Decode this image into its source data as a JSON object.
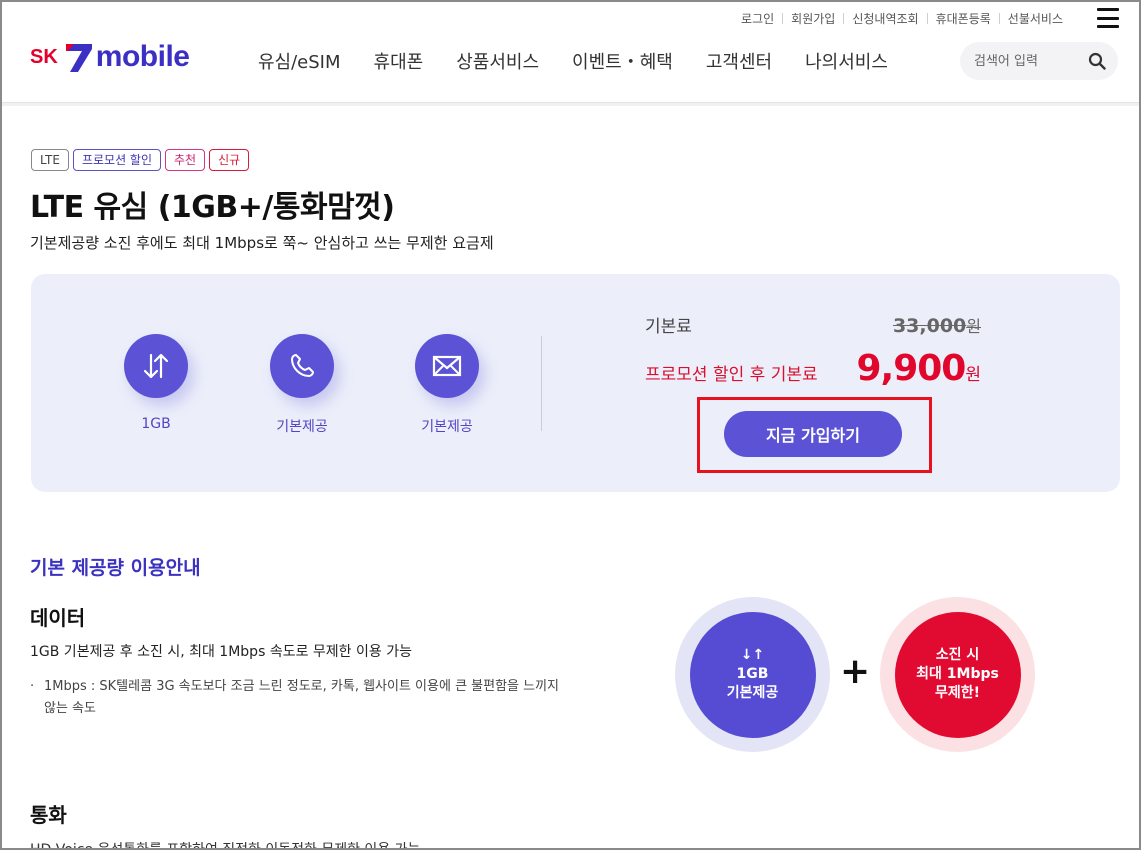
{
  "header": {
    "util_links": [
      "로그인",
      "회원가입",
      "신청내역조회",
      "휴대폰등록",
      "선불서비스"
    ],
    "logo": {
      "sk": "SK",
      "mobile": "mobile"
    },
    "nav": [
      "유심/eSIM",
      "휴대폰",
      "상품서비스",
      "이벤트・혜택",
      "고객센터",
      "나의서비스"
    ],
    "search": {
      "placeholder": "검색어 입력"
    }
  },
  "plan": {
    "badges": [
      "LTE",
      "프로모션 할인",
      "추천",
      "신규"
    ],
    "title": "LTE 유심 (1GB+/통화맘껏)",
    "subtitle": "기본제공량 소진 후에도 최대 1Mbps로 쭉~ 안심하고 쓰는 무제한 요금제",
    "features": [
      {
        "icon": "data-arrows-icon",
        "label": "1GB"
      },
      {
        "icon": "phone-icon",
        "label": "기본제공"
      },
      {
        "icon": "mail-icon",
        "label": "기본제공"
      }
    ],
    "price": {
      "base_label": "기본료",
      "base_value": "33,000",
      "promo_label": "프로모션 할인 후 기본료",
      "promo_value": "9,900",
      "currency": "원"
    },
    "cta": "지금 가입하기"
  },
  "usage": {
    "section_title": "기본 제공량 이용안내",
    "data_heading": "데이터",
    "data_desc": "1GB 기본제공 후 소진 시, 최대 1Mbps 속도로 무제한 이용 가능",
    "data_note": "1Mbps : SK텔레콤 3G 속도보다 조금 느린 정도로, 카톡, 웹사이트 이용에 큰 불편함을 느끼지 않는 속도",
    "circle_blue": {
      "arrow": "↓↑",
      "line1": "1GB",
      "line2": "기본제공"
    },
    "plus": "+",
    "circle_red": {
      "line1": "소진 시",
      "line2": "최대 1Mbps",
      "line3": "무제한!"
    },
    "call_heading": "통화",
    "call_desc_cut": "HD Voice 음성통화를 포함하여 집전화·이동전화 무제한 이용 가능"
  },
  "colors": {
    "brand_purple": "#5b52d6",
    "brand_red": "#e0062c",
    "highlight_box": "#e8121e"
  }
}
